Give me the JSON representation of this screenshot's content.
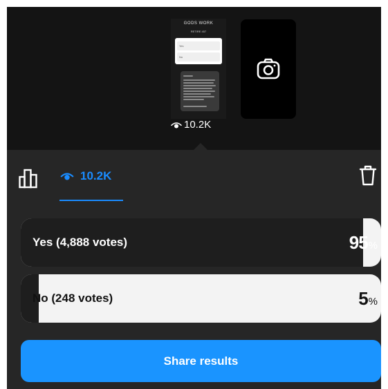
{
  "story_preview": {
    "title": "GODS WORK",
    "subtitle": "RETIRE 457",
    "poll_options": [
      "Yes",
      "No"
    ],
    "views": "10.2K"
  },
  "toolbar": {
    "views_tab_label": "10.2K"
  },
  "results": [
    {
      "label": "Yes (4,888 votes)",
      "percent": 95,
      "percent_text": "95",
      "symbol": "%"
    },
    {
      "label": "No (248 votes)",
      "percent": 5,
      "percent_text": "5",
      "symbol": "%"
    }
  ],
  "share_button_label": "Share results",
  "colors": {
    "accent": "#1a94ff",
    "fill": "#1e1e1e",
    "track": "#f3f3f3",
    "background": "#262626"
  }
}
